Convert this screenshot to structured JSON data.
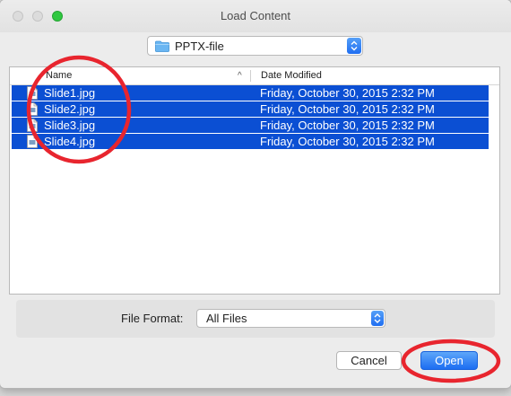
{
  "window": {
    "title": "Load Content"
  },
  "traffic_lights": [
    "close",
    "minimize",
    "zoom"
  ],
  "location": {
    "folder": "PPTX-file",
    "icon": "folder-icon"
  },
  "columns": {
    "name": "Name",
    "date_modified": "Date Modified",
    "sort_indicator": "^"
  },
  "files": [
    {
      "name": "Slide1.jpg",
      "date": "Friday, October 30, 2015 2:32 PM",
      "selected": true
    },
    {
      "name": "Slide2.jpg",
      "date": "Friday, October 30, 2015 2:32 PM",
      "selected": true
    },
    {
      "name": "Slide3.jpg",
      "date": "Friday, October 30, 2015 2:32 PM",
      "selected": true
    },
    {
      "name": "Slide4.jpg",
      "date": "Friday, October 30, 2015 2:32 PM",
      "selected": true
    }
  ],
  "format": {
    "label": "File Format:",
    "value": "All Files"
  },
  "buttons": {
    "cancel": "Cancel",
    "open": "Open"
  },
  "colors": {
    "selection": "#0b4fd3",
    "accent": "#1c6df2",
    "zoom_light": "#2fc840",
    "annotation_circle": "#e8252e"
  }
}
